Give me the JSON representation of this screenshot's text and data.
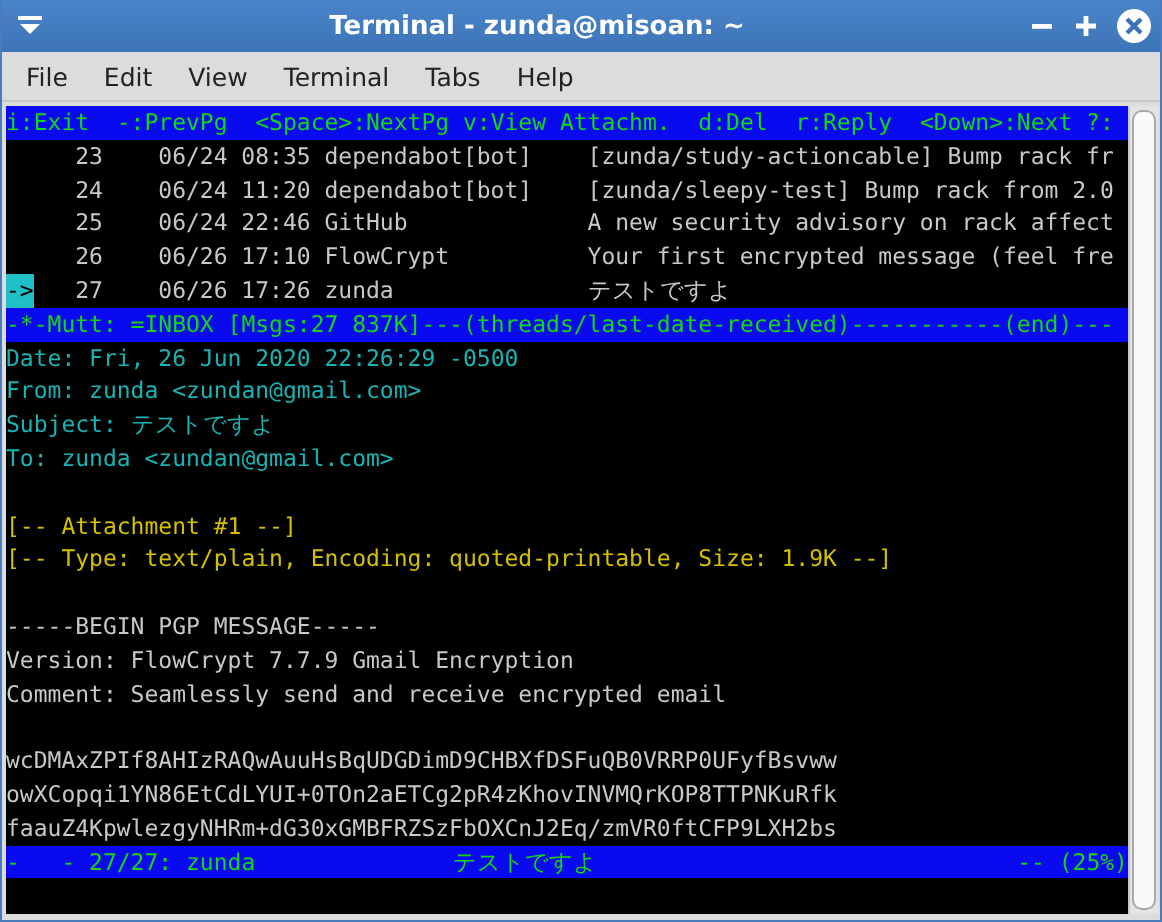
{
  "window": {
    "title": "Terminal - zunda@misoan: ~"
  },
  "menu": [
    {
      "label": "File"
    },
    {
      "label": "Edit"
    },
    {
      "label": "View"
    },
    {
      "label": "Terminal"
    },
    {
      "label": "Tabs"
    },
    {
      "label": "Help"
    }
  ],
  "terminal": {
    "help_bar": "i:Exit  -:PrevPg  <Space>:NextPg v:View Attachm.  d:Del  r:Reply  <Down>:Next ?:",
    "cursor_marker": "->",
    "messages": [
      {
        "number": "23",
        "date": "06/24 08:35",
        "sender": "dependabot[bot]",
        "subject": "[zunda/study-actioncable] Bump rack fr",
        "selected": false
      },
      {
        "number": "24",
        "date": "06/24 11:20",
        "sender": "dependabot[bot]",
        "subject": "[zunda/sleepy-test] Bump rack from 2.0",
        "selected": false
      },
      {
        "number": "25",
        "date": "06/24 22:46",
        "sender": "GitHub",
        "subject": "A new security advisory on rack affect",
        "selected": false
      },
      {
        "number": "26",
        "date": "06/26 17:10",
        "sender": "FlowCrypt",
        "subject": "Your first encrypted message (feel fre",
        "selected": false
      },
      {
        "number": "27",
        "date": "06/26 17:26",
        "sender": "zunda",
        "subject": "テストですよ",
        "selected": true
      }
    ],
    "index_status": "-*-Mutt: =INBOX [Msgs:27 837K]---(threads/last-date-received)-----------(end)---",
    "headers": [
      "Date: Fri, 26 Jun 2020 22:26:29 -0500",
      "From: zunda <zundan@gmail.com>",
      "Subject: テストですよ",
      "To: zunda <zundan@gmail.com>"
    ],
    "attachment_lines": [
      "[-- Attachment #1 --]",
      "[-- Type: text/plain, Encoding: quoted-printable, Size: 1.9K --]"
    ],
    "body_paragraphs": [
      [
        "-----BEGIN PGP MESSAGE-----",
        "Version: FlowCrypt 7.7.9 Gmail Encryption",
        "Comment: Seamlessly send and receive encrypted email"
      ],
      [
        "wcDMAxZPIf8AHIzRAQwAuuHsBqUDGDimD9CHBXfDSFuQB0VRRP0UFyfBsvww",
        "owXCopqi1YN86EtCdLYUI+0TOn2aETCg2pR4zKhovINVMQrKOP8TTPNKuRfk",
        "faauZ4KpwlezgyNHRm+dG30xGMBFRZSzFbOXCnJ2Eq/zmVR0ftCFP9LXH2bs"
      ]
    ],
    "pager_status": {
      "left": "-   - 27/27: zunda",
      "center": "テストですよ",
      "right": "-- (25%)"
    }
  }
}
